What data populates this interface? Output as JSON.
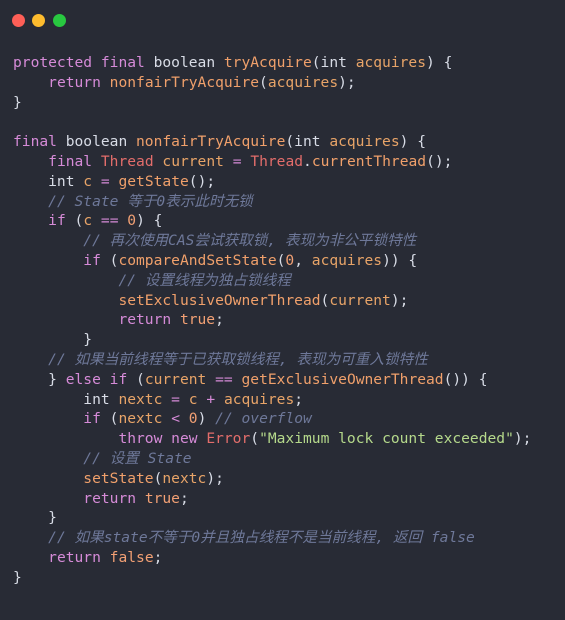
{
  "window": {
    "buttons": [
      "close",
      "minimize",
      "maximize"
    ]
  },
  "code": {
    "language": "java",
    "lines": [
      [
        [
          "kw",
          "protected"
        ],
        [
          "pl",
          " "
        ],
        [
          "kw",
          "final"
        ],
        [
          "pl",
          " boolean "
        ],
        [
          "fn",
          "tryAcquire"
        ],
        [
          "pl",
          "(int "
        ],
        [
          "vr",
          "acquires"
        ],
        [
          "pl",
          ") {"
        ]
      ],
      [
        [
          "pl",
          "    "
        ],
        [
          "kw",
          "return"
        ],
        [
          "pl",
          " "
        ],
        [
          "fn",
          "nonfairTryAcquire"
        ],
        [
          "pl",
          "("
        ],
        [
          "vr",
          "acquires"
        ],
        [
          "pl",
          ");"
        ]
      ],
      [
        [
          "pl",
          "}"
        ]
      ],
      [],
      [
        [
          "kw",
          "final"
        ],
        [
          "pl",
          " boolean "
        ],
        [
          "fn",
          "nonfairTryAcquire"
        ],
        [
          "pl",
          "(int "
        ],
        [
          "vr",
          "acquires"
        ],
        [
          "pl",
          ") {"
        ]
      ],
      [
        [
          "pl",
          "    "
        ],
        [
          "kw",
          "final"
        ],
        [
          "pl",
          " "
        ],
        [
          "ty",
          "Thread"
        ],
        [
          "pl",
          " "
        ],
        [
          "vr",
          "current"
        ],
        [
          "pl",
          " "
        ],
        [
          "kw",
          "="
        ],
        [
          "pl",
          " "
        ],
        [
          "ty",
          "Thread"
        ],
        [
          "pl",
          "."
        ],
        [
          "fn",
          "currentThread"
        ],
        [
          "pl",
          "();"
        ]
      ],
      [
        [
          "pl",
          "    int "
        ],
        [
          "vr",
          "c"
        ],
        [
          "pl",
          " "
        ],
        [
          "kw",
          "="
        ],
        [
          "pl",
          " "
        ],
        [
          "fn",
          "getState"
        ],
        [
          "pl",
          "();"
        ]
      ],
      [
        [
          "pl",
          "    "
        ],
        [
          "cm",
          "// State 等于0表示此时无锁"
        ]
      ],
      [
        [
          "pl",
          "    "
        ],
        [
          "kw",
          "if"
        ],
        [
          "pl",
          " ("
        ],
        [
          "vr",
          "c"
        ],
        [
          "pl",
          " "
        ],
        [
          "kw",
          "=="
        ],
        [
          "pl",
          " "
        ],
        [
          "nm",
          "0"
        ],
        [
          "pl",
          ") {"
        ]
      ],
      [
        [
          "pl",
          "        "
        ],
        [
          "cm",
          "// 再次使用CAS尝试获取锁, 表现为非公平锁特性"
        ]
      ],
      [
        [
          "pl",
          "        "
        ],
        [
          "kw",
          "if"
        ],
        [
          "pl",
          " ("
        ],
        [
          "fn",
          "compareAndSetState"
        ],
        [
          "pl",
          "("
        ],
        [
          "nm",
          "0"
        ],
        [
          "pl",
          ", "
        ],
        [
          "vr",
          "acquires"
        ],
        [
          "pl",
          ")) {"
        ]
      ],
      [
        [
          "pl",
          "            "
        ],
        [
          "cm",
          "// 设置线程为独占锁线程"
        ]
      ],
      [
        [
          "pl",
          "            "
        ],
        [
          "fn",
          "setExclusiveOwnerThread"
        ],
        [
          "pl",
          "("
        ],
        [
          "vr",
          "current"
        ],
        [
          "pl",
          ");"
        ]
      ],
      [
        [
          "pl",
          "            "
        ],
        [
          "kw",
          "return"
        ],
        [
          "pl",
          " "
        ],
        [
          "nm",
          "true"
        ],
        [
          "pl",
          ";"
        ]
      ],
      [
        [
          "pl",
          "        }"
        ]
      ],
      [
        [
          "pl",
          "    "
        ],
        [
          "cm",
          "// 如果当前线程等于已获取锁线程, 表现为可重入锁特性"
        ]
      ],
      [
        [
          "pl",
          "    } "
        ],
        [
          "kw",
          "else"
        ],
        [
          "pl",
          " "
        ],
        [
          "kw",
          "if"
        ],
        [
          "pl",
          " ("
        ],
        [
          "vr",
          "current"
        ],
        [
          "pl",
          " "
        ],
        [
          "kw",
          "=="
        ],
        [
          "pl",
          " "
        ],
        [
          "fn",
          "getExclusiveOwnerThread"
        ],
        [
          "pl",
          "()) {"
        ]
      ],
      [
        [
          "pl",
          "        int "
        ],
        [
          "vr",
          "nextc"
        ],
        [
          "pl",
          " "
        ],
        [
          "kw",
          "="
        ],
        [
          "pl",
          " "
        ],
        [
          "vr",
          "c"
        ],
        [
          "pl",
          " "
        ],
        [
          "kw",
          "+"
        ],
        [
          "pl",
          " "
        ],
        [
          "vr",
          "acquires"
        ],
        [
          "pl",
          ";"
        ]
      ],
      [
        [
          "pl",
          "        "
        ],
        [
          "kw",
          "if"
        ],
        [
          "pl",
          " ("
        ],
        [
          "vr",
          "nextc"
        ],
        [
          "pl",
          " "
        ],
        [
          "kw",
          "<"
        ],
        [
          "pl",
          " "
        ],
        [
          "nm",
          "0"
        ],
        [
          "pl",
          ") "
        ],
        [
          "cm",
          "// overflow"
        ]
      ],
      [
        [
          "pl",
          "            "
        ],
        [
          "kw",
          "throw"
        ],
        [
          "pl",
          " "
        ],
        [
          "kw",
          "new"
        ],
        [
          "pl",
          " "
        ],
        [
          "ty",
          "Error"
        ],
        [
          "pl",
          "("
        ],
        [
          "st",
          "\"Maximum lock count exceeded\""
        ],
        [
          "pl",
          ");"
        ]
      ],
      [
        [
          "pl",
          "        "
        ],
        [
          "cm",
          "// 设置 State"
        ]
      ],
      [
        [
          "pl",
          "        "
        ],
        [
          "fn",
          "setState"
        ],
        [
          "pl",
          "("
        ],
        [
          "vr",
          "nextc"
        ],
        [
          "pl",
          ");"
        ]
      ],
      [
        [
          "pl",
          "        "
        ],
        [
          "kw",
          "return"
        ],
        [
          "pl",
          " "
        ],
        [
          "nm",
          "true"
        ],
        [
          "pl",
          ";"
        ]
      ],
      [
        [
          "pl",
          "    }"
        ]
      ],
      [
        [
          "pl",
          "    "
        ],
        [
          "cm",
          "// 如果state不等于0并且独占线程不是当前线程, 返回 false"
        ]
      ],
      [
        [
          "pl",
          "    "
        ],
        [
          "kw",
          "return"
        ],
        [
          "pl",
          " "
        ],
        [
          "nm",
          "false"
        ],
        [
          "pl",
          ";"
        ]
      ],
      [
        [
          "pl",
          "}"
        ]
      ]
    ]
  }
}
